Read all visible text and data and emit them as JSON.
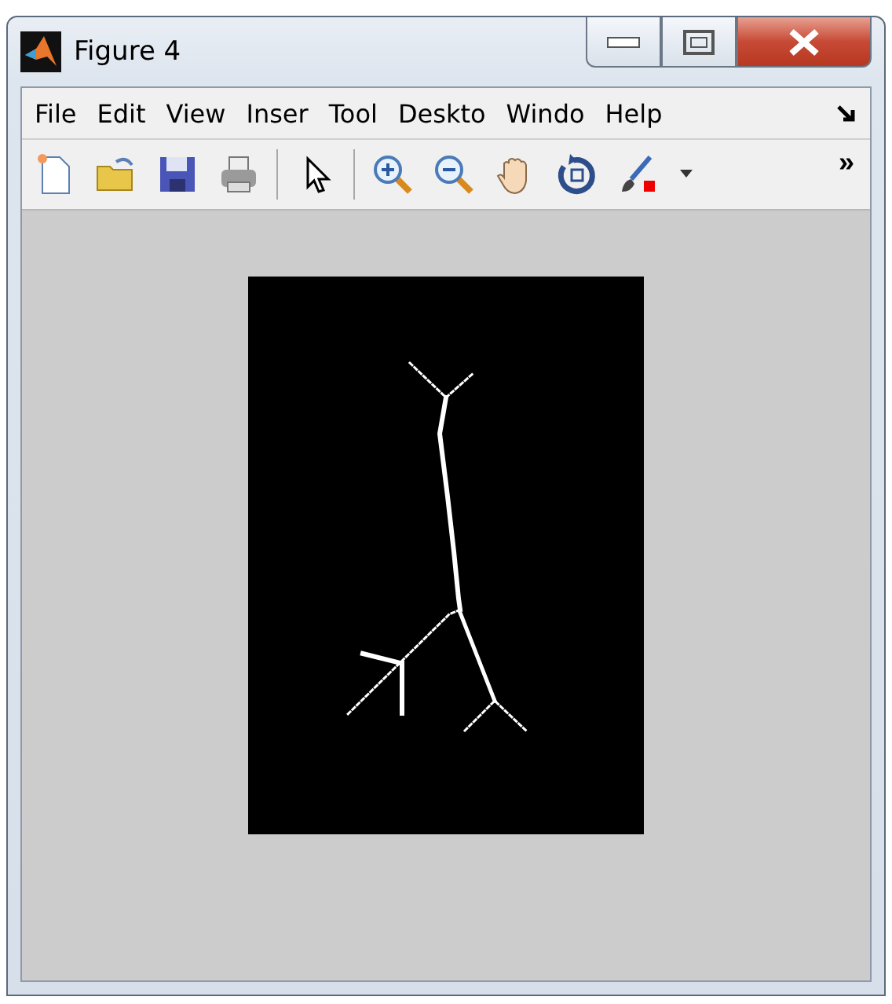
{
  "window": {
    "title": "Figure 4"
  },
  "menu": [
    "File",
    "Edit",
    "View",
    "Inser",
    "Tool",
    "Deskto",
    "Windo",
    "Help"
  ],
  "toolbar": {
    "overflow": "»"
  }
}
